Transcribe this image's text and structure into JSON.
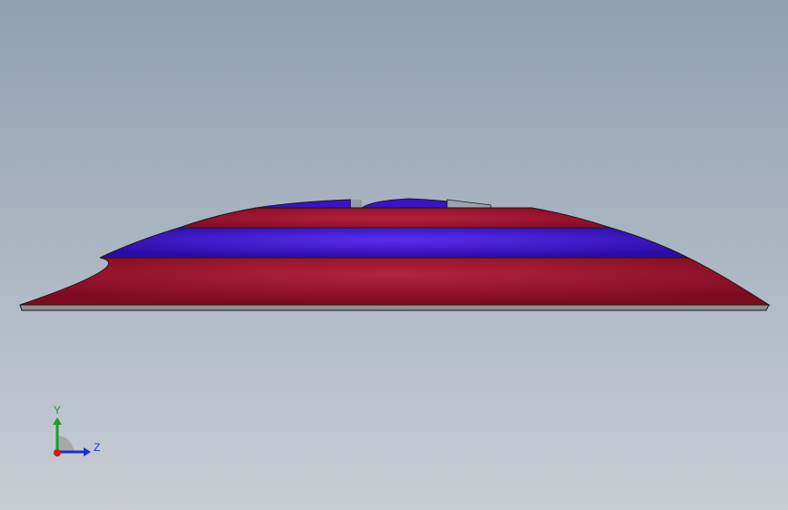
{
  "viewport": {
    "background_top": "#8fa0b3",
    "background_bottom": "#c9cdd3"
  },
  "model": {
    "colors": {
      "red": "#9a0f2a",
      "red_highlight": "#b3223f",
      "blue": "#3a12c9",
      "blue_highlight": "#5a2ef0",
      "base": "#8e8e8e",
      "edge": "#1a1a1a"
    }
  },
  "triad": {
    "y_label": "Y",
    "z_label": "Z",
    "y_color": "#18a02a",
    "z_color": "#1a2fd0",
    "x_color": "#d01a1a"
  }
}
